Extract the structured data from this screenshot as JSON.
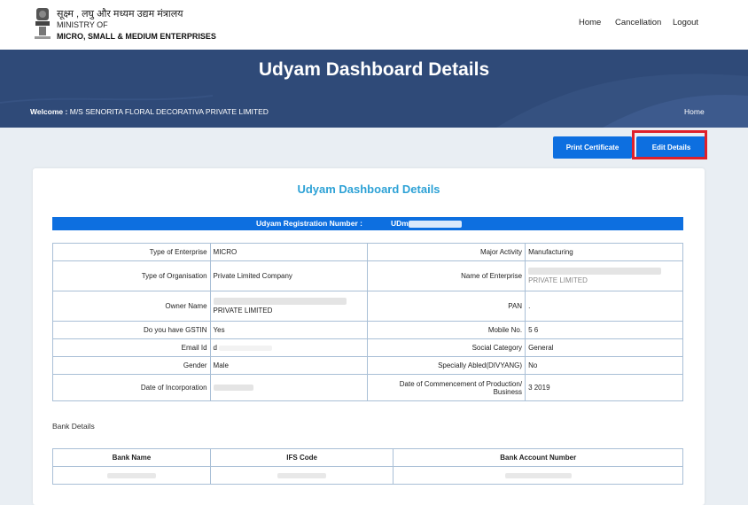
{
  "header": {
    "ministry_hindi": "सूक्ष्म , लघु और मध्यम उद्यम मंत्रालय",
    "ministry_line1": "MINISTRY OF",
    "ministry_line2": "MICRO, SMALL & MEDIUM ENTERPRISES",
    "nav": [
      "Home",
      "Cancellation",
      "Logout"
    ]
  },
  "banner": {
    "title": "Udyam Dashboard Details",
    "welcome_label": "Welcome :",
    "welcome_name": "M/S SENORITA FLORAL DECORATIVA PRIVATE LIMITED",
    "home": "Home"
  },
  "actions": {
    "print": "Print Certificate",
    "edit": "Edit Details"
  },
  "card": {
    "title": "Udyam Dashboard Details",
    "reg_label": "Udyam Registration Number  :",
    "reg_value": "UDm"
  },
  "details": {
    "rows": [
      [
        "Type of Enterprise",
        "MICRO",
        "Major Activity",
        "Manufacturing"
      ],
      [
        "Type of Organisation",
        "Private Limited Company",
        "Name of Enterprise",
        "PRIVATE LIMITED"
      ],
      [
        "Owner Name",
        "PRIVATE LIMITED",
        "PAN",
        "."
      ],
      [
        "Do you have GSTIN",
        "Yes",
        "Mobile No.",
        "5            6"
      ],
      [
        "Email Id",
        "d",
        "Social Category",
        "General"
      ],
      [
        "Gender",
        "Male",
        "Specially Abled(DIVYANG)",
        "No"
      ],
      [
        "Date of Incorporation",
        "",
        "Date of Commencement of Production/ Business",
        "3     2019"
      ]
    ]
  },
  "bank": {
    "heading": "Bank Details",
    "headers": [
      "Bank Name",
      "IFS Code",
      "Bank Account Number"
    ],
    "values": [
      "",
      "",
      ""
    ]
  },
  "colors": {
    "accent_blue": "#0d6fe0",
    "banner": "#2f4a78",
    "title_cyan": "#2ea2d6",
    "highlight_red": "#e0202a"
  }
}
